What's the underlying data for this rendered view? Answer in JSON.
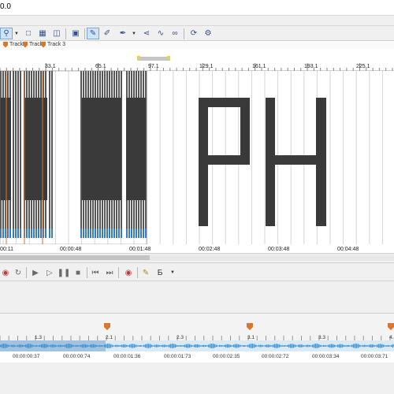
{
  "window": {
    "title_fragment": "0.0"
  },
  "toolbar": {
    "icons": [
      "zoom-select-icon",
      "dropdown-arrow-icon",
      "envelope-icon",
      "event-pan-icon",
      "auto-crossfade-icon",
      "grid-snap-icon",
      "draw-tool-icon",
      "pencil-icon",
      "dropdown-arrow-icon",
      "envelope-edit-icon",
      "split-icon",
      "loop-icon",
      "settings-icon"
    ]
  },
  "markers": [
    {
      "label": "Track"
    },
    {
      "label": "Track"
    },
    {
      "label": "Track 3"
    }
  ],
  "ruler": {
    "labels": [
      "33.1",
      "65.1",
      "97.1",
      "129.1",
      "161.1",
      "193.1",
      "225.1"
    ]
  },
  "timeline": {
    "overlay_text": "PH",
    "colors": {
      "event_dark": "#3a3a3a",
      "event_blue": "#3a7bbf",
      "grid": "#d6d6d6",
      "cursor": "#d9772e"
    }
  },
  "timecodes": [
    "00:11",
    "00:00:48",
    "00:01:48",
    "00:02:48",
    "00:03:48",
    "00:04:48"
  ],
  "transport": {
    "icons": [
      "record-icon",
      "loop-icon",
      "play-from-start-icon",
      "play-icon",
      "pause-icon",
      "stop-icon",
      "go-to-start-icon",
      "go-to-end-icon",
      "record-arm-icon",
      "mixer-icon",
      "metronome-icon",
      "dropdown-arrow-icon"
    ]
  },
  "bottom_panel": {
    "ruler_labels": [
      "1.3",
      "2.1",
      "2.3",
      "3.1",
      "3.3",
      "4."
    ],
    "timecodes": [
      "00:00:00:37",
      "00:00:00:74",
      "00:00:01:36",
      "00:00:01:73",
      "00:00:02:35",
      "00:00:02:72",
      "00:00:03:34",
      "00:00:03:71"
    ],
    "colors": {
      "wave_bg": "#dbe9f3",
      "wave_fg": "#4a8fc4",
      "marker": "#d9772e"
    }
  }
}
